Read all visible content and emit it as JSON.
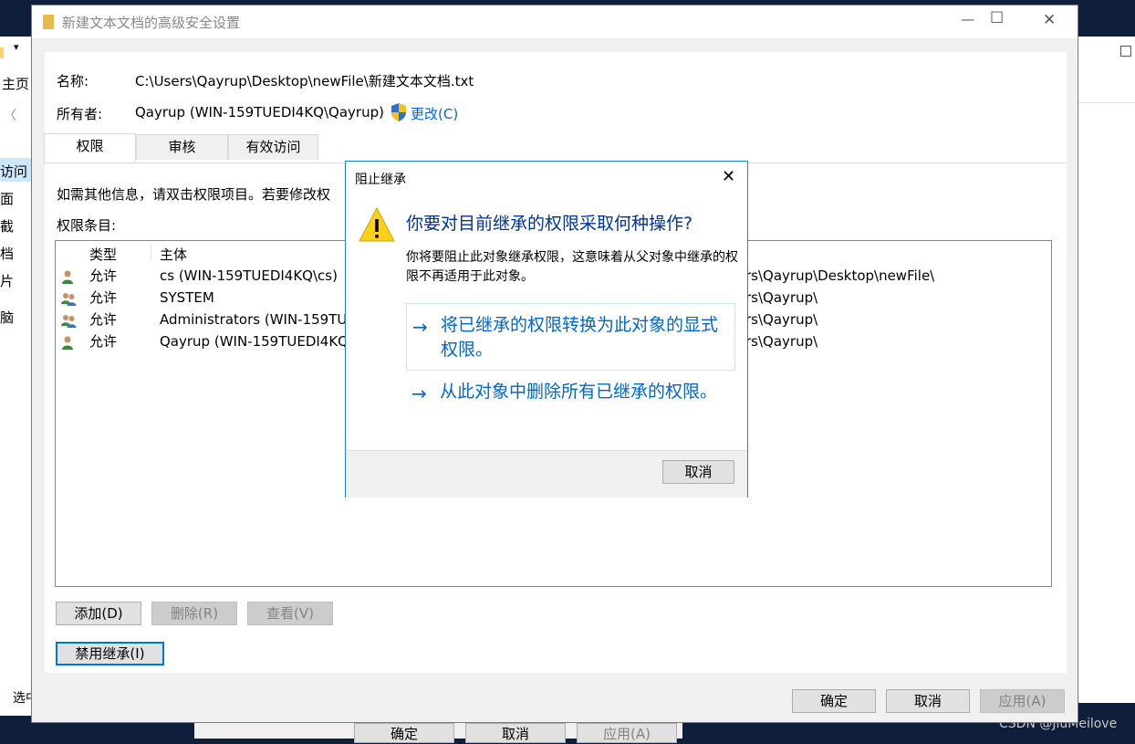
{
  "background": {
    "side_items": [
      "主页",
      "访问",
      "面",
      "截",
      "档",
      "片",
      "脑"
    ],
    "statusbar_text": "选中",
    "bottom_buttons": [
      "确定",
      "取消",
      "应用(A)"
    ],
    "watermark": "CSDN @JiuMeilove"
  },
  "window": {
    "title": "新建文本文档的高级安全设置",
    "controls": {
      "minimize": "—",
      "maximize": "☐",
      "close": "✕"
    }
  },
  "header": {
    "name_label": "名称:",
    "name_value": "C:\\Users\\Qayrup\\Desktop\\newFile\\新建文本文档.txt",
    "owner_label": "所有者:",
    "owner_value": "Qayrup (WIN-159TUEDI4KQ\\Qayrup)",
    "change_link": "更改(C)"
  },
  "tabs": [
    {
      "label": "权限",
      "active": true
    },
    {
      "label": "审核",
      "active": false
    },
    {
      "label": "有效访问",
      "active": false
    }
  ],
  "info_text": "如需其他信息，请双击权限项目。若要修改权",
  "entries_label": "权限条目:",
  "table": {
    "columns": [
      "类型",
      "主体"
    ],
    "rows": [
      {
        "icon": "user-icon",
        "type": "允许",
        "principal": "cs (WIN-159TUEDI4KQ\\cs)",
        "inherited": "rs\\Qayrup\\Desktop\\newFile\\"
      },
      {
        "icon": "group-icon",
        "type": "允许",
        "principal": "SYSTEM",
        "inherited": "rs\\Qayrup\\"
      },
      {
        "icon": "group-icon",
        "type": "允许",
        "principal": "Administrators (WIN-159TU",
        "inherited": "rs\\Qayrup\\"
      },
      {
        "icon": "user-icon",
        "type": "允许",
        "principal": "Qayrup (WIN-159TUEDI4KQ\\",
        "inherited": "rs\\Qayrup\\"
      }
    ]
  },
  "buttons": {
    "add": "添加(D)",
    "remove": "删除(R)",
    "view": "查看(V)",
    "disable_inheritance": "禁用继承(I)",
    "ok": "确定",
    "cancel": "取消",
    "apply": "应用(A)"
  },
  "dialog": {
    "title": "阻止继承",
    "close": "✕",
    "heading": "你要对目前继承的权限采取何种操作?",
    "description": "你将要阻止此对象继承权限，这意味着从父对象中继承的权限不再适用于此对象。",
    "option1": "将已继承的权限转换为此对象的显式权限。",
    "option2": "从此对象中删除所有已继承的权限。",
    "arrow": "→",
    "cancel": "取消"
  },
  "colors": {
    "accent": "#0078d7",
    "link": "#0066cc",
    "heading": "#003399"
  }
}
